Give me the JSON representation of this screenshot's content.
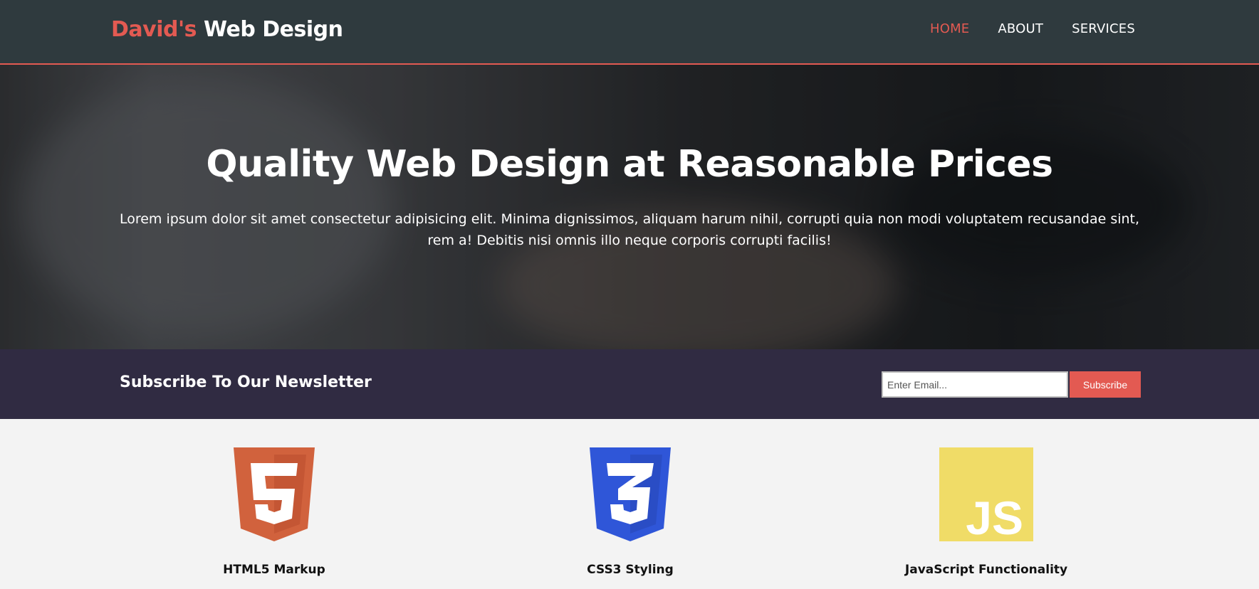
{
  "header": {
    "brand_accent": "David's",
    "brand_rest": " Web Design",
    "nav": [
      {
        "label": "HOME",
        "active": true
      },
      {
        "label": "ABOUT",
        "active": false
      },
      {
        "label": "SERVICES",
        "active": false
      }
    ]
  },
  "hero": {
    "title": "Quality Web Design at Reasonable Prices",
    "text": "Lorem ipsum dolor sit amet consectetur adipisicing elit. Minima dignissimos, aliquam harum nihil, corrupti quia non modi voluptatem recusandae sint, rem a! Debitis nisi omnis illo neque corporis corrupti facilis!"
  },
  "newsletter": {
    "title": "Subscribe To Our Newsletter",
    "email_placeholder": "Enter Email...",
    "button_label": "Subscribe"
  },
  "features": [
    {
      "icon": "html5-icon",
      "title": "HTML5 Markup",
      "color": "#d1623d"
    },
    {
      "icon": "css3-icon",
      "title": "CSS3 Styling",
      "color": "#2f56d8"
    },
    {
      "icon": "javascript-icon",
      "title": "JavaScript Functionality",
      "color": "#f0dc67",
      "text": "JS"
    }
  ],
  "colors": {
    "accent": "#e35a52",
    "header_bg": "#2f3a3e",
    "newsletter_bg": "#302b42",
    "page_bg": "#f3f3f3"
  }
}
